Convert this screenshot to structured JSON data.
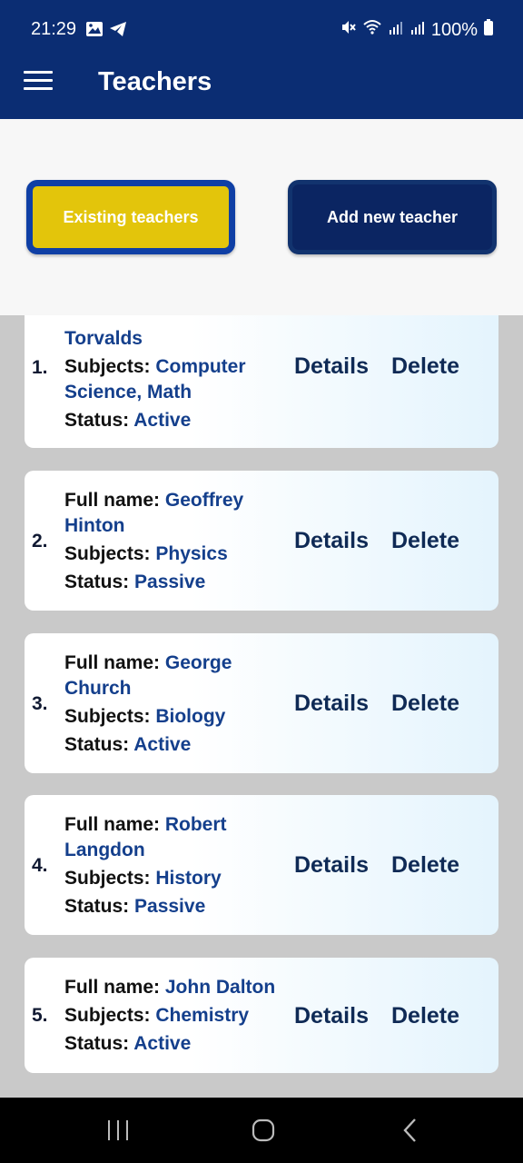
{
  "status_bar": {
    "time": "21:29",
    "battery": "100%"
  },
  "app_bar": {
    "title": "Teachers"
  },
  "tabs": {
    "existing_label": "Existing teachers",
    "add_label": "Add new teacher"
  },
  "labels": {
    "full_name": "Full name: ",
    "subjects": "Subjects: ",
    "status": "Status: ",
    "details": "Details",
    "delete": "Delete"
  },
  "teachers": [
    {
      "index": "1.",
      "name_visible": "Torvalds",
      "subjects": "Computer Science, Math",
      "status": "Active"
    },
    {
      "index": "2.",
      "name": "Geoffrey Hinton",
      "subjects": "Physics",
      "status": "Passive"
    },
    {
      "index": "3.",
      "name": "George Church",
      "subjects": "Biology",
      "status": "Active"
    },
    {
      "index": "4.",
      "name": "Robert Langdon",
      "subjects": "History",
      "status": "Passive"
    },
    {
      "index": "5.",
      "name": "John Dalton",
      "subjects": "Chemistry",
      "status": "Active"
    }
  ],
  "colors": {
    "primary": "#0b2d73",
    "accent": "#e3c50b",
    "value_text": "#143f8c"
  }
}
